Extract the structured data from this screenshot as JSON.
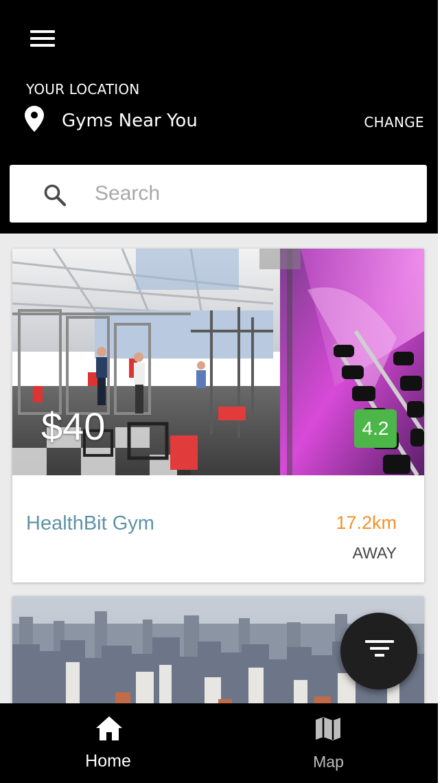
{
  "header": {
    "location_label": "YOUR LOCATION",
    "location_name": "Gyms Near You",
    "change_label": "CHANGE"
  },
  "search": {
    "placeholder": "Search",
    "value": ""
  },
  "gyms": [
    {
      "price": "$40",
      "rating": "4.2",
      "name": "HealthBit Gym",
      "distance": "17.2km",
      "distance_suffix": "AWAY"
    }
  ],
  "bottom_nav": {
    "items": [
      {
        "label": "Home",
        "icon": "home-icon",
        "active": true
      },
      {
        "label": "Map",
        "icon": "map-icon",
        "active": false
      }
    ]
  },
  "colors": {
    "header_bg": "#000000",
    "rating_bg": "#4cb648",
    "gym_name": "#5e93a6",
    "distance": "#f0922c",
    "fab_bg": "#1f1f1f"
  }
}
